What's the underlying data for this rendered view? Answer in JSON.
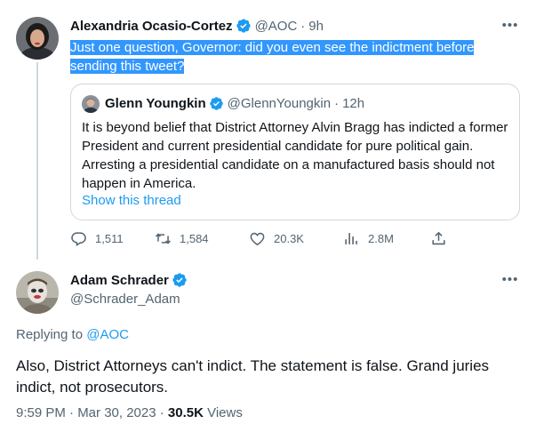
{
  "tweet": {
    "author_name": "Alexandria Ocasio-Cortez",
    "handle": "@AOC",
    "separator": "·",
    "time": "9h",
    "text": "Just one question, Governor: did you even see the indictment before sending this tweet?",
    "quoted": {
      "author_name": "Glenn Youngkin",
      "handle": "@GlennYoungkin",
      "separator": "·",
      "time": "12h",
      "text": "It is beyond belief that District Attorney Alvin Bragg has indicted a former President and current presidential candidate for pure political gain. Arresting a presidential candidate on a manufactured basis should not happen in America.",
      "show_thread": "Show this thread"
    },
    "actions": {
      "replies": "1,511",
      "retweets": "1,584",
      "likes": "20.3K",
      "views": "2.8M"
    }
  },
  "reply": {
    "author_name": "Adam Schrader",
    "handle": "@Schrader_Adam",
    "replying_prefix": "Replying to",
    "replying_to": "@AOC",
    "text": "Also, District Attorneys can't indict. The statement is false. Grand juries indict, not prosecutors.",
    "timestamp": "9:59 PM · Mar 30, 2023 · ",
    "views_count": "30.5K",
    "views_label": " Views"
  },
  "icons": {
    "verified": "verified-badge-icon",
    "more": "more-options-icon",
    "reply": "reply-icon",
    "retweet": "retweet-icon",
    "like": "heart-icon",
    "views": "analytics-icon",
    "share": "share-icon"
  },
  "colors": {
    "accent": "#1d9bf0",
    "muted": "#536471",
    "border": "#cfd9de",
    "selection": "#3297fd"
  }
}
